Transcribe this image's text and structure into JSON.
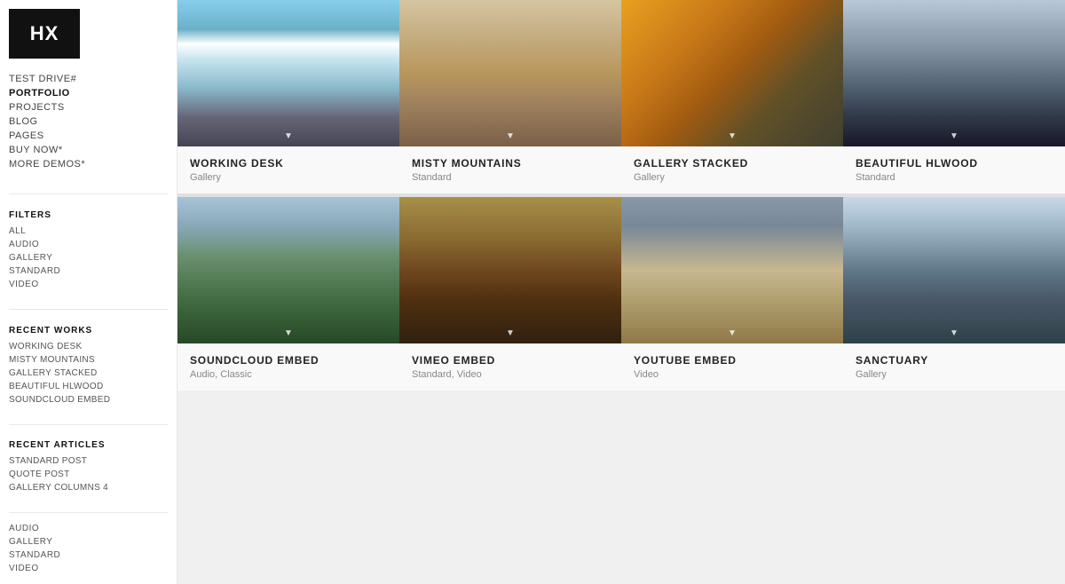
{
  "logo": {
    "text": "HX"
  },
  "nav": {
    "items": [
      {
        "label": "TEST DRIVE#",
        "active": false
      },
      {
        "label": "PORTFOLIO",
        "active": true
      },
      {
        "label": "PROJECTS",
        "active": false
      },
      {
        "label": "BLOG",
        "active": false
      },
      {
        "label": "PAGES",
        "active": false
      },
      {
        "label": "BUY NOW*",
        "active": false
      },
      {
        "label": "MORE DEMOS*",
        "active": false
      }
    ]
  },
  "filters": {
    "title": "FILTERS",
    "items": [
      {
        "label": "ALL"
      },
      {
        "label": "AUDIO"
      },
      {
        "label": "GALLERY"
      },
      {
        "label": "STANDARD"
      },
      {
        "label": "VIDEO"
      }
    ]
  },
  "recent_works": {
    "title": "RECENT WORKS",
    "items": [
      {
        "label": "WORKING DESK"
      },
      {
        "label": "MISTY MOUNTAINS"
      },
      {
        "label": "GALLERY STACKED"
      },
      {
        "label": "BEAUTIFUL HLWOOD"
      },
      {
        "label": "SOUNDCLOUD EMBED"
      }
    ]
  },
  "recent_articles": {
    "title": "RECENT ARTICLES",
    "items": [
      {
        "label": "STANDARD POST"
      },
      {
        "label": "QUOTE POST"
      },
      {
        "label": "GALLERY COLUMNS 4"
      }
    ]
  },
  "bottom_filters": {
    "items": [
      {
        "label": "AUDIO"
      },
      {
        "label": "GALLERY"
      },
      {
        "label": "STANDARD"
      },
      {
        "label": "VIDEO"
      }
    ]
  },
  "portfolio": {
    "items": [
      {
        "id": 1,
        "title": "WORKING DESK",
        "type": "Gallery",
        "img_class": "img-waterfall"
      },
      {
        "id": 2,
        "title": "MISTY MOUNTAINS",
        "type": "Standard",
        "img_class": "img-person-hat"
      },
      {
        "id": 3,
        "title": "GALLERY STACKED",
        "type": "Gallery",
        "img_class": "img-beach-surfboard"
      },
      {
        "id": 4,
        "title": "BEAUTIFUL HLWOOD",
        "type": "Standard",
        "img_class": "img-photographer"
      },
      {
        "id": 5,
        "title": "SOUNDCLOUD EMBED",
        "type": "Audio, Classic",
        "img_class": "img-mountains-green"
      },
      {
        "id": 6,
        "title": "VIMEO EMBED",
        "type": "Standard, Video",
        "img_class": "img-person-road"
      },
      {
        "id": 7,
        "title": "YOUTUBE EMBED",
        "type": "Video",
        "img_class": "img-beach-cloudy"
      },
      {
        "id": 8,
        "title": "SANCTUARY",
        "type": "Gallery",
        "img_class": "img-mountains-hikers"
      }
    ]
  }
}
